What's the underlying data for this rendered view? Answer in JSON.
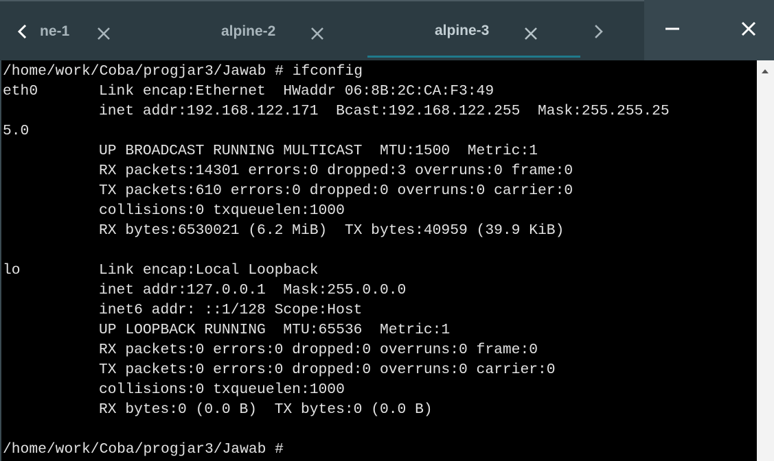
{
  "tabs": [
    {
      "label": "ne-1",
      "active": false
    },
    {
      "label": "alpine-2",
      "active": false
    },
    {
      "label": "alpine-3",
      "active": true
    }
  ],
  "icons": {
    "scroll_left": "chevron-left-icon",
    "scroll_right": "chevron-right-icon",
    "tab_close": "close-icon",
    "minimize": "minimize-icon",
    "close_window": "close-icon",
    "scroll_up": "triangle-up-icon"
  },
  "colors": {
    "tab_indicator": "#1f7a8c",
    "titlebar": "#37474f",
    "terminal_bg": "#000000",
    "terminal_fg": "#e2e2e2"
  },
  "terminal": {
    "lines": [
      {
        "col0": "/home/work/Coba/progjar3/Jawab # ifconfig",
        "col1": ""
      },
      {
        "col0": "eth0",
        "col1": "Link encap:Ethernet  HWaddr 06:8B:2C:CA:F3:49"
      },
      {
        "col0": "",
        "col1": "inet addr:192.168.122.171  Bcast:192.168.122.255  Mask:255.255.25"
      },
      {
        "col0": "5.0",
        "col1": ""
      },
      {
        "col0": "",
        "col1": "UP BROADCAST RUNNING MULTICAST  MTU:1500  Metric:1"
      },
      {
        "col0": "",
        "col1": "RX packets:14301 errors:0 dropped:3 overruns:0 frame:0"
      },
      {
        "col0": "",
        "col1": "TX packets:610 errors:0 dropped:0 overruns:0 carrier:0"
      },
      {
        "col0": "",
        "col1": "collisions:0 txqueuelen:1000"
      },
      {
        "col0": "",
        "col1": "RX bytes:6530021 (6.2 MiB)  TX bytes:40959 (39.9 KiB)"
      },
      {
        "col0": "",
        "col1": ""
      },
      {
        "col0": "lo",
        "col1": "Link encap:Local Loopback"
      },
      {
        "col0": "",
        "col1": "inet addr:127.0.0.1  Mask:255.0.0.0"
      },
      {
        "col0": "",
        "col1": "inet6 addr: ::1/128 Scope:Host"
      },
      {
        "col0": "",
        "col1": "UP LOOPBACK RUNNING  MTU:65536  Metric:1"
      },
      {
        "col0": "",
        "col1": "RX packets:0 errors:0 dropped:0 overruns:0 frame:0"
      },
      {
        "col0": "",
        "col1": "TX packets:0 errors:0 dropped:0 overruns:0 carrier:0"
      },
      {
        "col0": "",
        "col1": "collisions:0 txqueuelen:1000"
      },
      {
        "col0": "",
        "col1": "RX bytes:0 (0.0 B)  TX bytes:0 (0.0 B)"
      },
      {
        "col0": "",
        "col1": ""
      },
      {
        "col0": "/home/work/Coba/progjar3/Jawab #",
        "col1": ""
      }
    ]
  }
}
